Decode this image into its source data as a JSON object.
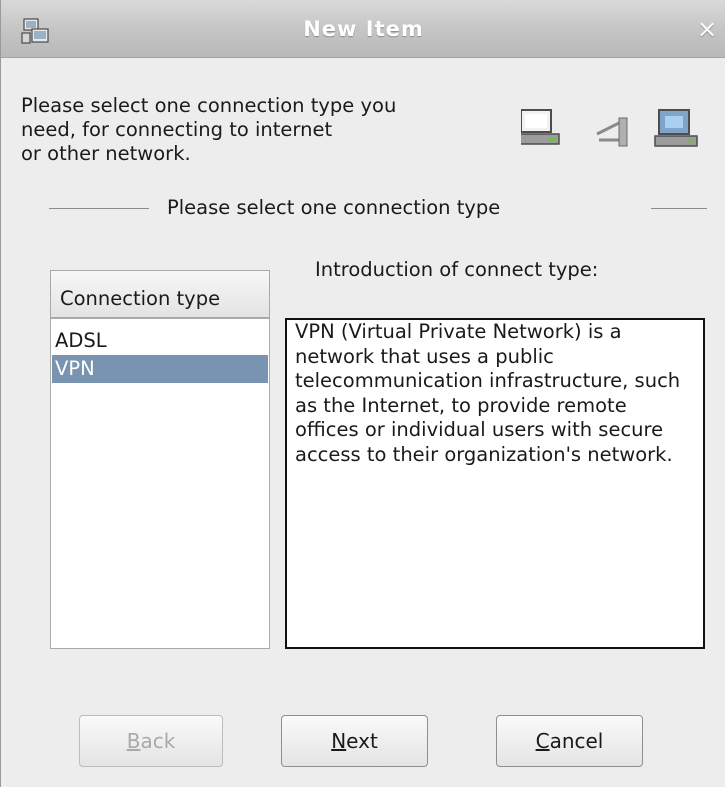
{
  "window": {
    "title": "New Item",
    "close_glyph": "×",
    "icon": "network-setup-icon"
  },
  "intro": {
    "text": "Please select one connection type you\nneed, for connecting to internet\nor other network.",
    "icons": [
      "computer-icon",
      "cable-icon",
      "network-device-icon"
    ]
  },
  "separator": {
    "label": "Please select one connection type"
  },
  "connection_list": {
    "header": "Connection type",
    "items": [
      {
        "label": "ADSL",
        "selected": false
      },
      {
        "label": "VPN",
        "selected": true
      }
    ]
  },
  "introduction": {
    "label": "Introduction of connect type:",
    "text": "VPN (Virtual Private Network) is a network that uses a public telecommunication infrastructure, such as the Internet, to provide remote offices or individual users with secure access to their organization's network."
  },
  "buttons": {
    "back": {
      "mnemonic": "B",
      "rest": "ack",
      "enabled": false
    },
    "next": {
      "mnemonic": "N",
      "rest": "ext",
      "enabled": true
    },
    "cancel": {
      "mnemonic": "C",
      "rest": "ancel",
      "enabled": true
    }
  },
  "colors": {
    "titlebar": "#c4c4c4",
    "window_bg": "#ededed",
    "selection": "#7894b0"
  }
}
